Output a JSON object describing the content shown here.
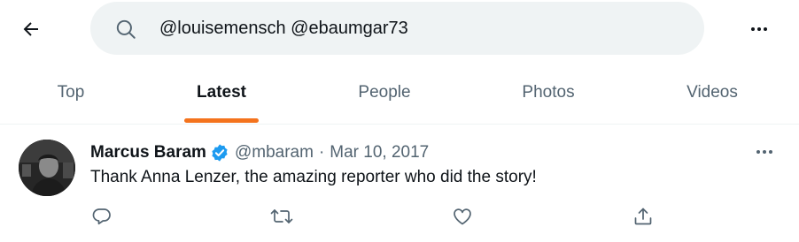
{
  "header": {
    "search_value": "@louisemensch @ebaumgar73",
    "back_icon": "arrow-left-icon",
    "more_icon": "more-horizontal-icon"
  },
  "tabs": [
    {
      "label": "Top",
      "active": false
    },
    {
      "label": "Latest",
      "active": true
    },
    {
      "label": "People",
      "active": false
    },
    {
      "label": "Photos",
      "active": false
    },
    {
      "label": "Videos",
      "active": false
    }
  ],
  "tweet": {
    "author_name": "Marcus Baram",
    "verified": true,
    "handle": "@mbaram",
    "separator": "·",
    "date": "Mar 10, 2017",
    "text": "Thank Anna Lenzer, the amazing reporter who did the story!",
    "actions": [
      "reply-icon",
      "retweet-icon",
      "like-icon",
      "share-icon"
    ]
  },
  "colors": {
    "accent": "#f4731d",
    "verified": "#1d9bf0",
    "muted": "#536471",
    "search_bg": "#eff3f4"
  }
}
